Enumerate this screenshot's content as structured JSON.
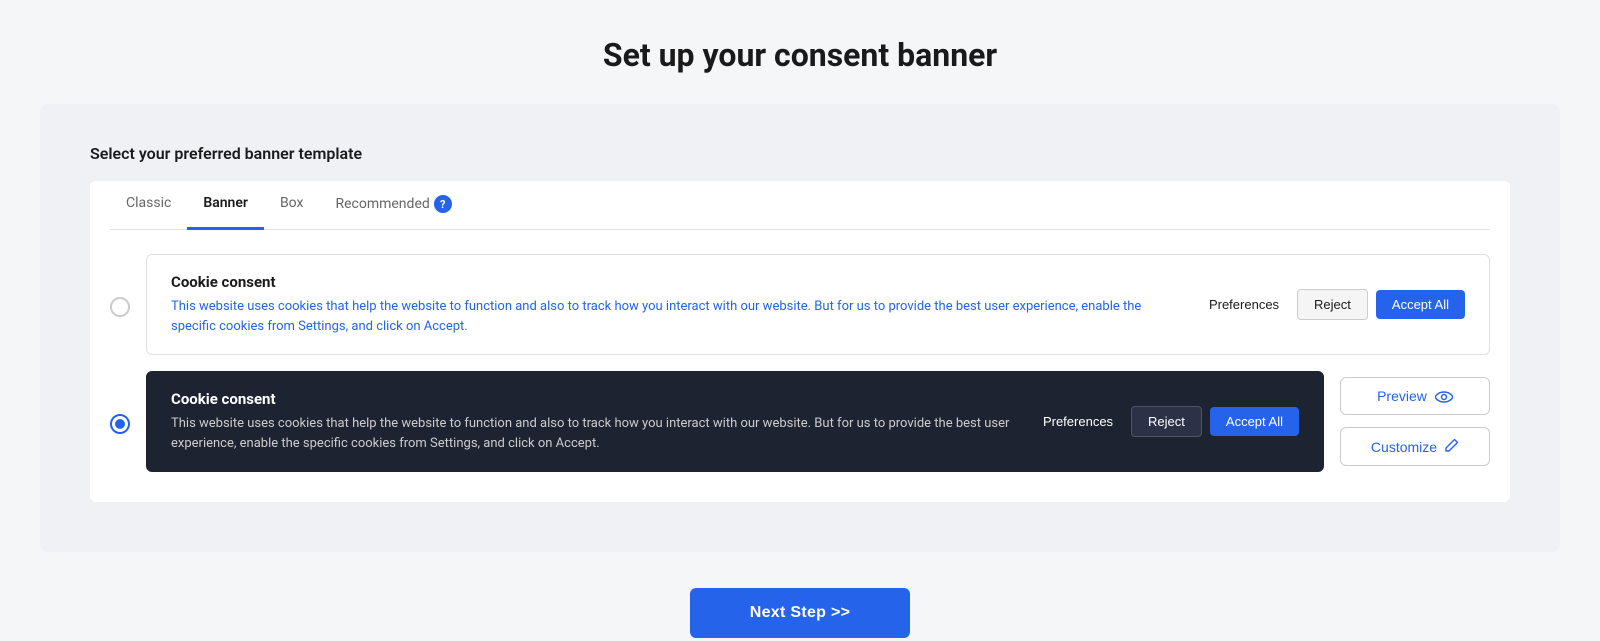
{
  "page": {
    "title": "Set up your consent banner"
  },
  "section": {
    "label": "Select your preferred banner template"
  },
  "tabs": [
    {
      "id": "classic",
      "label": "Classic",
      "active": false
    },
    {
      "id": "banner",
      "label": "Banner",
      "active": true
    },
    {
      "id": "box",
      "label": "Box",
      "active": false
    },
    {
      "id": "recommended",
      "label": "Recommended",
      "active": false,
      "has_help": true
    }
  ],
  "templates": [
    {
      "id": "light",
      "selected": false,
      "title": "Cookie consent",
      "description": "This website uses cookies that help the website to function and also to track how you interact with our website. But for us to provide the best user experience, enable the specific cookies from Settings, and click on Accept.",
      "dark": false,
      "buttons": {
        "preferences": "Preferences",
        "reject": "Reject",
        "accept_all": "Accept All"
      }
    },
    {
      "id": "dark",
      "selected": true,
      "title": "Cookie consent",
      "description": "This website uses cookies that help the website to function and also to track how you interact with our website. But for us to provide the best user experience, enable the specific cookies from Settings, and click on Accept.",
      "dark": true,
      "buttons": {
        "preferences": "Preferences",
        "reject": "Reject",
        "accept_all": "Accept All"
      }
    }
  ],
  "side_buttons": {
    "preview": "Preview",
    "customize": "Customize"
  },
  "next_step_button": "Next Step >>"
}
